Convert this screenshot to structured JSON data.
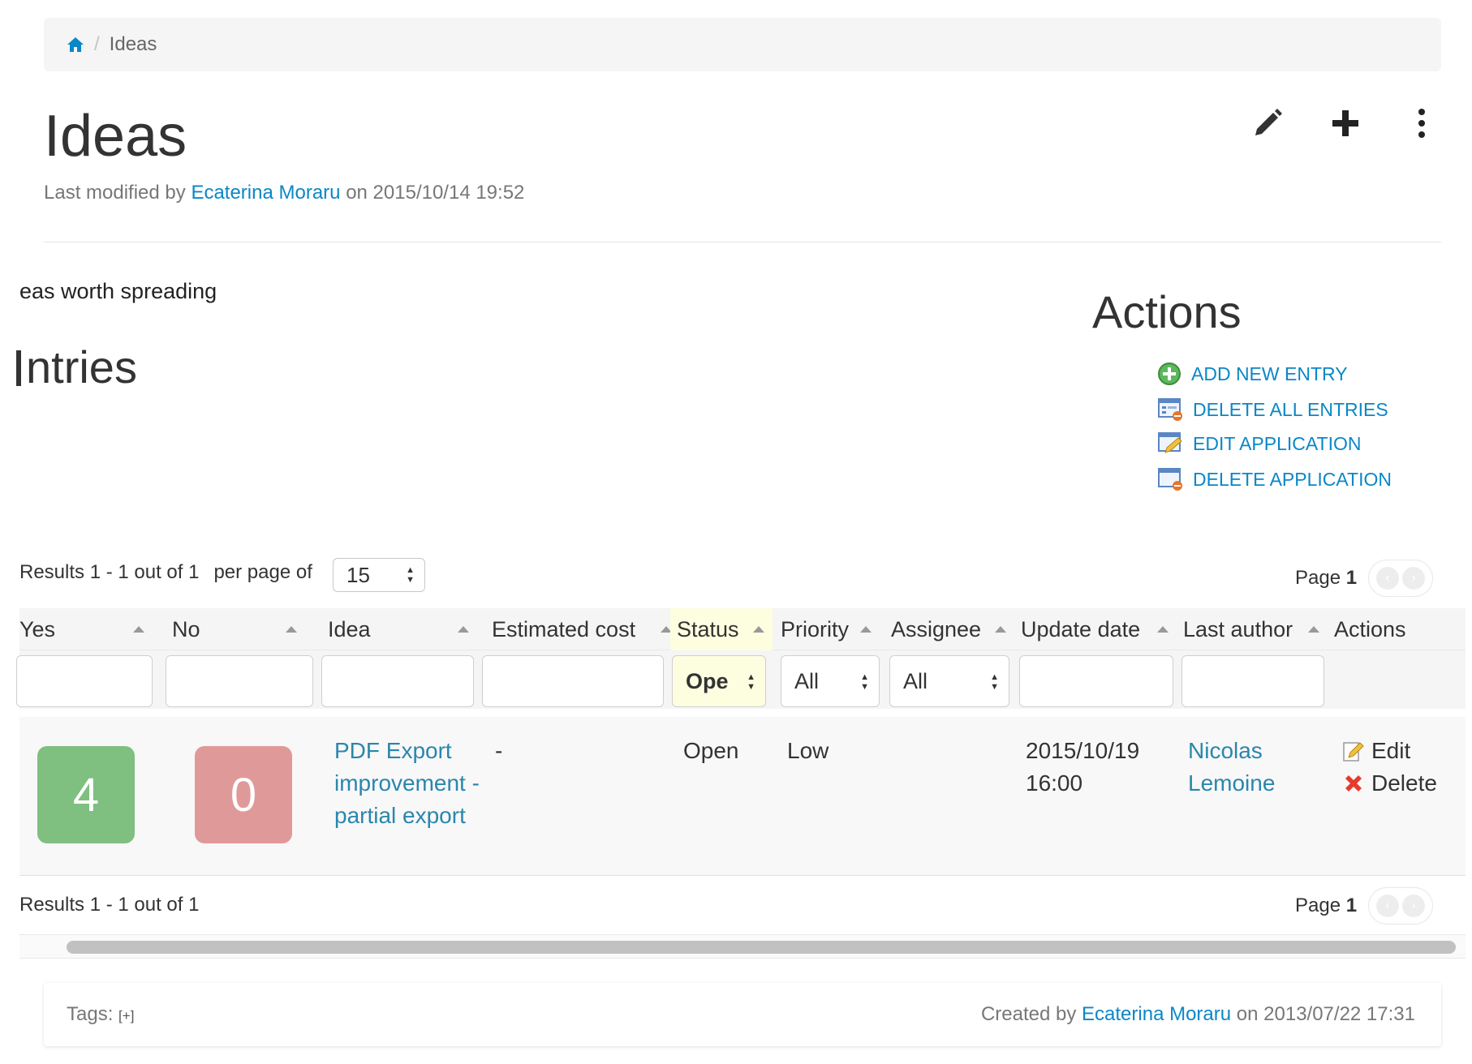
{
  "breadcrumb": {
    "current": "Ideas"
  },
  "page": {
    "title": "Ideas",
    "modified_prefix": "Last modified by",
    "modified_user": "Ecaterina Moraru",
    "modified_suffix": "on 2015/10/14 19:52"
  },
  "content": {
    "tagline": "eas worth spreading",
    "entries_heading": "ntries"
  },
  "actions": {
    "title": "Actions",
    "items": [
      {
        "label": "ADD NEW ENTRY",
        "icon": "add-icon"
      },
      {
        "label": "DELETE ALL ENTRIES",
        "icon": "delete-entries-icon"
      },
      {
        "label": "EDIT APPLICATION",
        "icon": "edit-app-icon"
      },
      {
        "label": "DELETE APPLICATION",
        "icon": "delete-app-icon"
      }
    ]
  },
  "livetable": {
    "results_text": "Results 1 - 1 out of 1",
    "per_page_label": "per page of",
    "per_page_value": "15",
    "page_label": "Page",
    "page_number": "1",
    "columns": [
      "Yes",
      "No",
      "Idea",
      "Estimated cost",
      "Status",
      "Priority",
      "Assignee",
      "Update date",
      "Last author",
      "Actions"
    ],
    "filters": {
      "status": "Ope",
      "priority": "All",
      "assignee": "All"
    },
    "row": {
      "yes": "4",
      "no": "0",
      "idea": "PDF Export improvement - partial export",
      "cost": "-",
      "status": "Open",
      "priority": "Low",
      "update_date": "2015/10/19 16:00",
      "last_author": "Nicolas Lemoine",
      "edit": "Edit",
      "delete": "Delete"
    }
  },
  "footer": {
    "tags_label": "Tags:",
    "tags_add": "[+]",
    "created_prefix": "Created by",
    "created_user": "Ecaterina Moraru",
    "created_suffix": "on 2013/07/22 17:31"
  },
  "colors": {
    "link": "#0a87c7",
    "yes_bg": "#7fbf7f",
    "no_bg": "#e09999",
    "status_highlight": "#fdfde0"
  }
}
